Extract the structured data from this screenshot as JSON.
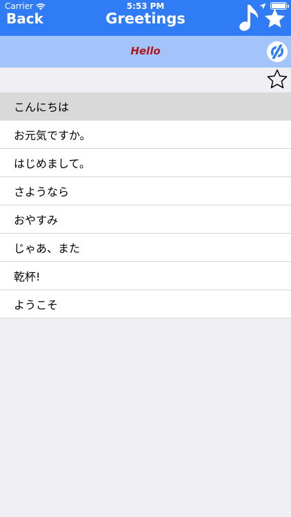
{
  "status_bar": {
    "carrier": "Carrier",
    "time": "5:53 PM",
    "battery_level": 1.0
  },
  "nav": {
    "back_label": "Back",
    "title": "Greetings",
    "icons": [
      "music-note-icon",
      "star-icon"
    ]
  },
  "subheader": {
    "title": "Hello",
    "icon": "translate-icon"
  },
  "toolbar": {
    "icon": "star-outline-icon"
  },
  "phrases": [
    {
      "text": "こんにちは",
      "selected": true
    },
    {
      "text": "お元気ですか。",
      "selected": false
    },
    {
      "text": "はじめまして。",
      "selected": false
    },
    {
      "text": "さようなら",
      "selected": false
    },
    {
      "text": "おやすみ",
      "selected": false
    },
    {
      "text": "じゃあ、また",
      "selected": false
    },
    {
      "text": "乾杯!",
      "selected": false
    },
    {
      "text": "ようこそ",
      "selected": false
    }
  ],
  "colors": {
    "nav_background": "#2f7cf6",
    "subheader_background": "#a3c3fb",
    "subheader_text": "#b4161b",
    "selected_row": "#d9d9d9",
    "page_background": "#efeff4"
  }
}
